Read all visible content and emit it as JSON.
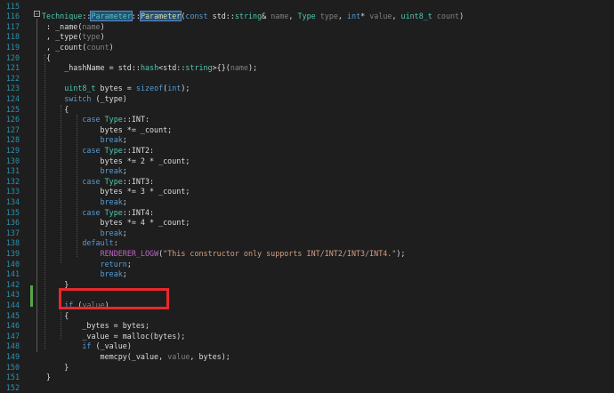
{
  "editor": {
    "lines": [
      {
        "num": "115",
        "tokens": []
      },
      {
        "num": "116",
        "tokens": [
          {
            "t": "Technique",
            "c": "ty"
          },
          {
            "t": "::",
            "c": "pl"
          },
          {
            "t": "Parameter",
            "c": "ty hl"
          },
          {
            "t": "::",
            "c": "pl"
          },
          {
            "t": "Parameter",
            "c": "fn hl"
          },
          {
            "t": "(",
            "c": "pl"
          },
          {
            "t": "const",
            "c": "kw"
          },
          {
            "t": " std::",
            "c": "pl"
          },
          {
            "t": "string",
            "c": "ty"
          },
          {
            "t": "& ",
            "c": "pl"
          },
          {
            "t": "name",
            "c": "pm"
          },
          {
            "t": ", ",
            "c": "pl"
          },
          {
            "t": "Type",
            "c": "ty"
          },
          {
            "t": " ",
            "c": "pl"
          },
          {
            "t": "type",
            "c": "pm"
          },
          {
            "t": ", ",
            "c": "pl"
          },
          {
            "t": "int",
            "c": "kw"
          },
          {
            "t": "* ",
            "c": "pl"
          },
          {
            "t": "value",
            "c": "pm"
          },
          {
            "t": ", ",
            "c": "pl"
          },
          {
            "t": "uint8_t",
            "c": "ty"
          },
          {
            "t": " ",
            "c": "pl"
          },
          {
            "t": "count",
            "c": "pm"
          },
          {
            "t": ")",
            "c": "pl"
          }
        ]
      },
      {
        "num": "117",
        "tokens": [
          {
            "t": " : _name(",
            "c": "pl"
          },
          {
            "t": "name",
            "c": "pm"
          },
          {
            "t": ")",
            "c": "pl"
          }
        ]
      },
      {
        "num": "118",
        "tokens": [
          {
            "t": " , _type(",
            "c": "pl"
          },
          {
            "t": "type",
            "c": "pm"
          },
          {
            "t": ")",
            "c": "pl"
          }
        ]
      },
      {
        "num": "119",
        "tokens": [
          {
            "t": " , _count(",
            "c": "pl"
          },
          {
            "t": "count",
            "c": "pm"
          },
          {
            "t": ")",
            "c": "pl"
          }
        ]
      },
      {
        "num": "120",
        "tokens": [
          {
            "t": " {",
            "c": "pl"
          }
        ]
      },
      {
        "num": "121",
        "tokens": [
          {
            "t": "     _hashName = std::",
            "c": "pl"
          },
          {
            "t": "hash",
            "c": "ty"
          },
          {
            "t": "<std::",
            "c": "pl"
          },
          {
            "t": "string",
            "c": "ty"
          },
          {
            "t": ">{}(",
            "c": "pl"
          },
          {
            "t": "name",
            "c": "pm"
          },
          {
            "t": ");",
            "c": "pl"
          }
        ]
      },
      {
        "num": "122",
        "tokens": []
      },
      {
        "num": "123",
        "tokens": [
          {
            "t": "     ",
            "c": "pl"
          },
          {
            "t": "uint8_t",
            "c": "ty"
          },
          {
            "t": " bytes = ",
            "c": "pl"
          },
          {
            "t": "sizeof",
            "c": "kw"
          },
          {
            "t": "(",
            "c": "pl"
          },
          {
            "t": "int",
            "c": "kw"
          },
          {
            "t": ");",
            "c": "pl"
          }
        ]
      },
      {
        "num": "124",
        "tokens": [
          {
            "t": "     ",
            "c": "pl"
          },
          {
            "t": "switch",
            "c": "kw"
          },
          {
            "t": " (_type)",
            "c": "pl"
          }
        ]
      },
      {
        "num": "125",
        "tokens": [
          {
            "t": "     {",
            "c": "pl"
          }
        ]
      },
      {
        "num": "126",
        "tokens": [
          {
            "t": "         ",
            "c": "pl"
          },
          {
            "t": "case",
            "c": "kw"
          },
          {
            "t": " ",
            "c": "pl"
          },
          {
            "t": "Type",
            "c": "ty"
          },
          {
            "t": "::INT:",
            "c": "pl"
          }
        ]
      },
      {
        "num": "127",
        "tokens": [
          {
            "t": "             bytes *= _count;",
            "c": "pl"
          }
        ]
      },
      {
        "num": "128",
        "tokens": [
          {
            "t": "             ",
            "c": "pl"
          },
          {
            "t": "break",
            "c": "kw"
          },
          {
            "t": ";",
            "c": "pl"
          }
        ]
      },
      {
        "num": "129",
        "tokens": [
          {
            "t": "         ",
            "c": "pl"
          },
          {
            "t": "case",
            "c": "kw"
          },
          {
            "t": " ",
            "c": "pl"
          },
          {
            "t": "Type",
            "c": "ty"
          },
          {
            "t": "::INT2:",
            "c": "pl"
          }
        ]
      },
      {
        "num": "130",
        "tokens": [
          {
            "t": "             bytes *= 2 * _count;",
            "c": "pl"
          }
        ]
      },
      {
        "num": "131",
        "tokens": [
          {
            "t": "             ",
            "c": "pl"
          },
          {
            "t": "break",
            "c": "kw"
          },
          {
            "t": ";",
            "c": "pl"
          }
        ]
      },
      {
        "num": "132",
        "tokens": [
          {
            "t": "         ",
            "c": "pl"
          },
          {
            "t": "case",
            "c": "kw"
          },
          {
            "t": " ",
            "c": "pl"
          },
          {
            "t": "Type",
            "c": "ty"
          },
          {
            "t": "::INT3:",
            "c": "pl"
          }
        ]
      },
      {
        "num": "133",
        "tokens": [
          {
            "t": "             bytes *= 3 * _count;",
            "c": "pl"
          }
        ]
      },
      {
        "num": "134",
        "tokens": [
          {
            "t": "             ",
            "c": "pl"
          },
          {
            "t": "break",
            "c": "kw"
          },
          {
            "t": ";",
            "c": "pl"
          }
        ]
      },
      {
        "num": "135",
        "tokens": [
          {
            "t": "         ",
            "c": "pl"
          },
          {
            "t": "case",
            "c": "kw"
          },
          {
            "t": " ",
            "c": "pl"
          },
          {
            "t": "Type",
            "c": "ty"
          },
          {
            "t": "::INT4:",
            "c": "pl"
          }
        ]
      },
      {
        "num": "136",
        "tokens": [
          {
            "t": "             bytes *= 4 * _count;",
            "c": "pl"
          }
        ]
      },
      {
        "num": "137",
        "tokens": [
          {
            "t": "             ",
            "c": "pl"
          },
          {
            "t": "break",
            "c": "kw"
          },
          {
            "t": ";",
            "c": "pl"
          }
        ]
      },
      {
        "num": "138",
        "tokens": [
          {
            "t": "         ",
            "c": "pl"
          },
          {
            "t": "default",
            "c": "kw"
          },
          {
            "t": ":",
            "c": "pl"
          }
        ]
      },
      {
        "num": "139",
        "tokens": [
          {
            "t": "             ",
            "c": "pl"
          },
          {
            "t": "RENDERER_LOGW",
            "c": "mc"
          },
          {
            "t": "(",
            "c": "pl"
          },
          {
            "t": "\"This constructor only supports INT/INT2/INT3/INT4.\"",
            "c": "st"
          },
          {
            "t": ");",
            "c": "pl"
          }
        ]
      },
      {
        "num": "140",
        "tokens": [
          {
            "t": "             ",
            "c": "pl"
          },
          {
            "t": "return",
            "c": "kw"
          },
          {
            "t": ";",
            "c": "pl"
          }
        ]
      },
      {
        "num": "141",
        "tokens": [
          {
            "t": "             ",
            "c": "pl"
          },
          {
            "t": "break",
            "c": "kw"
          },
          {
            "t": ";",
            "c": "pl"
          }
        ]
      },
      {
        "num": "142",
        "tokens": [
          {
            "t": "     }",
            "c": "pl"
          }
        ]
      },
      {
        "num": "143",
        "tokens": []
      },
      {
        "num": "144",
        "tokens": [
          {
            "t": "     ",
            "c": "pl"
          },
          {
            "t": "if",
            "c": "kw"
          },
          {
            "t": " (",
            "c": "pl"
          },
          {
            "t": "value",
            "c": "pm"
          },
          {
            "t": ")",
            "c": "pl"
          }
        ]
      },
      {
        "num": "145",
        "tokens": [
          {
            "t": "     {",
            "c": "pl"
          }
        ]
      },
      {
        "num": "146",
        "tokens": [
          {
            "t": "         _bytes = bytes;",
            "c": "pl"
          }
        ]
      },
      {
        "num": "147",
        "tokens": [
          {
            "t": "         _value = malloc(bytes);",
            "c": "pl"
          }
        ]
      },
      {
        "num": "148",
        "tokens": [
          {
            "t": "         ",
            "c": "pl"
          },
          {
            "t": "if",
            "c": "kw"
          },
          {
            "t": " (_value)",
            "c": "pl"
          }
        ]
      },
      {
        "num": "149",
        "tokens": [
          {
            "t": "             memcpy(_value, ",
            "c": "pl"
          },
          {
            "t": "value",
            "c": "pm"
          },
          {
            "t": ", bytes);",
            "c": "pl"
          }
        ]
      },
      {
        "num": "150",
        "tokens": [
          {
            "t": "     }",
            "c": "pl"
          }
        ]
      },
      {
        "num": "151",
        "tokens": [
          {
            "t": " }",
            "c": "pl"
          }
        ]
      },
      {
        "num": "152",
        "tokens": []
      }
    ],
    "fold_glyph": "−",
    "colors": {
      "background": "#1e1e1e",
      "line_number": "#2b91af",
      "keyword": "#569cd6",
      "type": "#4ec9b0",
      "function": "#dcdcaa",
      "parameter": "#808080",
      "macro": "#bd63c5",
      "string": "#d69d85",
      "annotation_box": "#e8282b",
      "change_bar": "#57a64a"
    }
  }
}
